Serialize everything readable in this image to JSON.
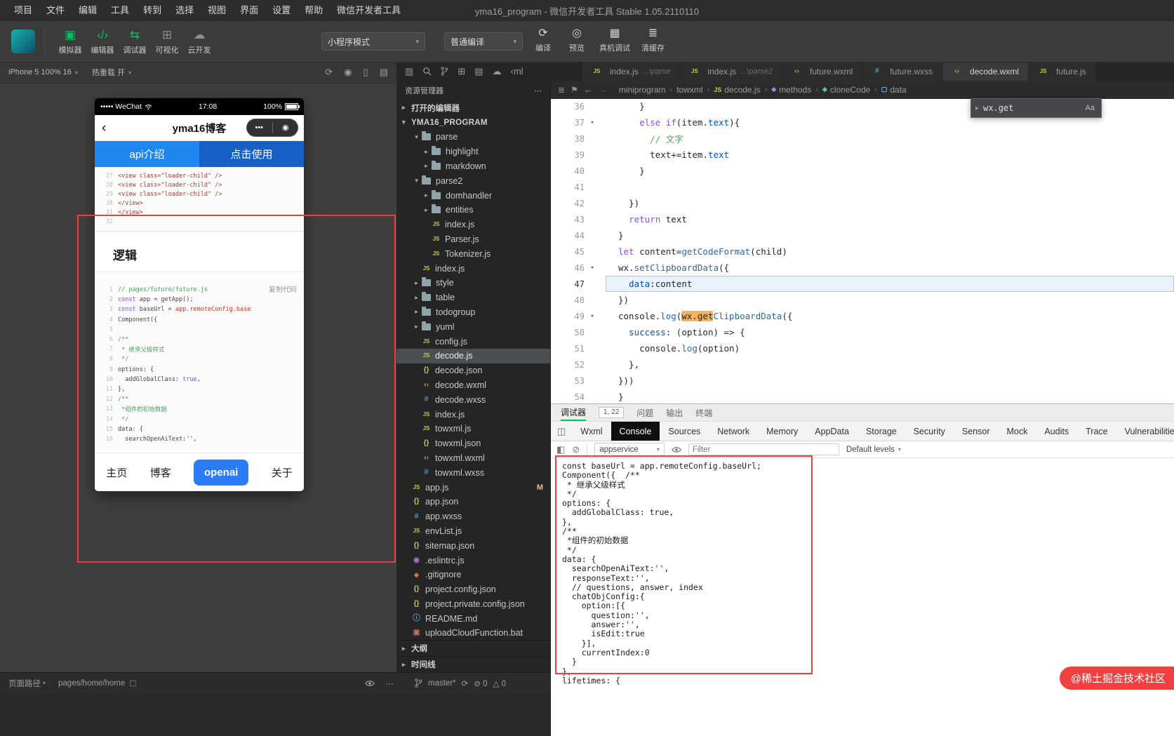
{
  "menubar": {
    "items": [
      "项目",
      "文件",
      "编辑",
      "工具",
      "转到",
      "选择",
      "视图",
      "界面",
      "设置",
      "帮助",
      "微信开发者工具"
    ],
    "title": "yma16_program - 微信开发者工具 Stable 1.05.2110110"
  },
  "toolbar": {
    "nav_buttons": [
      {
        "name": "simulator",
        "label": "模拟器",
        "active": true
      },
      {
        "name": "editor",
        "label": "编辑器",
        "active": true
      },
      {
        "name": "debugger",
        "label": "调试器",
        "active": true
      },
      {
        "name": "visual",
        "label": "可视化",
        "active": false
      },
      {
        "name": "clouddev",
        "label": "云开发",
        "active": false
      }
    ],
    "mode_select": "小程序模式",
    "compile_select": "普通编译",
    "action_buttons": [
      {
        "name": "compile",
        "label": "编译"
      },
      {
        "name": "preview",
        "label": "预览"
      },
      {
        "name": "remote-debug",
        "label": "真机调试"
      },
      {
        "name": "clear-cache",
        "label": "清缓存"
      }
    ]
  },
  "simulator": {
    "device_label": "iPhone 5 100% 16",
    "hot_reload_label": "热重载 开",
    "toolbar_icons": [
      "rotate",
      "record",
      "device",
      "screenshot"
    ],
    "phone": {
      "status": {
        "carrier": "••••• WeChat",
        "time": "17:08",
        "battery": "100%"
      },
      "nav_title": "yma16博客",
      "capsule": {
        "more": "•••",
        "target": "◉"
      },
      "tabs": [
        {
          "label": "api介绍",
          "color": "#1e88f0"
        },
        {
          "label": "点击使用",
          "color": "#1660c8"
        }
      ],
      "wxml_lines": [
        {
          "no": "27",
          "t": "<view class=\"loader-child\" />"
        },
        {
          "no": "28",
          "t": "<view class=\"loader-child\" />"
        },
        {
          "no": "29",
          "t": "<view class=\"loader-child\" />"
        },
        {
          "no": "30",
          "t": "</view>"
        },
        {
          "no": "31",
          "t": "</view>"
        },
        {
          "no": "32",
          "t": ""
        }
      ],
      "section_title": "逻辑",
      "copy_label": "复制代码",
      "logic_lines": [
        {
          "no": "1",
          "seg": [
            [
              "// pages/future/future.js",
              "c"
            ]
          ]
        },
        {
          "no": "2",
          "seg": [
            [
              "const ",
              "k"
            ],
            [
              "app = getApp();",
              ""
            ]
          ]
        },
        {
          "no": "3",
          "seg": [
            [
              "const ",
              "k"
            ],
            [
              "baseUrl = ",
              ""
            ],
            [
              "app.remoteConfig.base",
              "r"
            ]
          ]
        },
        {
          "no": "4",
          "seg": [
            [
              "Component({",
              ""
            ]
          ]
        },
        {
          "no": "5",
          "seg": [
            [
              "",
              ""
            ]
          ]
        },
        {
          "no": "6",
          "seg": [
            [
              "/**",
              "c"
            ]
          ]
        },
        {
          "no": "7",
          "seg": [
            [
              " * 继承父级样式",
              "c"
            ]
          ]
        },
        {
          "no": "8",
          "seg": [
            [
              " */",
              "c"
            ]
          ]
        },
        {
          "no": "9",
          "seg": [
            [
              "options: {",
              ""
            ]
          ]
        },
        {
          "no": "10",
          "seg": [
            [
              "  addGlobalClass: ",
              ""
            ],
            [
              "true",
              "k"
            ],
            [
              ",",
              ""
            ]
          ]
        },
        {
          "no": "11",
          "seg": [
            [
              "},",
              ""
            ]
          ]
        },
        {
          "no": "12",
          "seg": [
            [
              "/**",
              "c"
            ]
          ]
        },
        {
          "no": "13",
          "seg": [
            [
              " *组件的初始数据",
              "c"
            ]
          ]
        },
        {
          "no": "14",
          "seg": [
            [
              " */",
              "c"
            ]
          ]
        },
        {
          "no": "15",
          "seg": [
            [
              "data: {",
              ""
            ]
          ]
        },
        {
          "no": "16",
          "seg": [
            [
              "  searchOpenAiText:'',",
              ""
            ]
          ]
        }
      ],
      "tabbar": [
        {
          "label": "主页",
          "primary": false
        },
        {
          "label": "博客",
          "primary": false
        },
        {
          "label": "openai",
          "primary": true
        },
        {
          "label": "关于",
          "primary": false
        }
      ],
      "primary_color": "#2a7cf7"
    }
  },
  "explorer": {
    "toolbar_icons": [
      "files",
      "search",
      "branch",
      "split",
      "panel",
      "cloud",
      "ml"
    ],
    "panel_title": "资源管理器",
    "more_label": "⋯",
    "open_editors_label": "打开的编辑器",
    "project_label": "YMA16_PROGRAM",
    "tree": [
      {
        "label": "parse",
        "type": "folder",
        "arrow": "down",
        "indent": 1
      },
      {
        "label": "highlight",
        "type": "folder",
        "arrow": "right",
        "indent": 2
      },
      {
        "label": "markdown",
        "type": "folder",
        "arrow": "right",
        "indent": 2
      },
      {
        "label": "parse2",
        "type": "folder",
        "arrow": "down",
        "indent": 1
      },
      {
        "label": "domhandler",
        "type": "folder",
        "arrow": "right",
        "indent": 2
      },
      {
        "label": "entities",
        "type": "folder",
        "arrow": "right",
        "indent": 2
      },
      {
        "label": "index.js",
        "type": "js",
        "indent": 2
      },
      {
        "label": "Parser.js",
        "type": "js",
        "indent": 2
      },
      {
        "label": "Tokenizer.js",
        "type": "js",
        "indent": 2
      },
      {
        "label": "index.js",
        "type": "js",
        "indent": 1
      },
      {
        "label": "style",
        "type": "folder",
        "arrow": "right",
        "indent": 1
      },
      {
        "label": "table",
        "type": "folder",
        "arrow": "right",
        "indent": 1
      },
      {
        "label": "todogroup",
        "type": "folder",
        "arrow": "right",
        "indent": 1
      },
      {
        "label": "yuml",
        "type": "folder",
        "arrow": "right",
        "indent": 1
      },
      {
        "label": "config.js",
        "type": "js",
        "indent": 1
      },
      {
        "label": "decode.js",
        "type": "js",
        "indent": 1,
        "selected": true
      },
      {
        "label": "decode.json",
        "type": "json",
        "indent": 1
      },
      {
        "label": "decode.wxml",
        "type": "wxml",
        "indent": 1
      },
      {
        "label": "decode.wxss",
        "type": "wxss",
        "indent": 1
      },
      {
        "label": "index.js",
        "type": "js",
        "indent": 1
      },
      {
        "label": "towxml.js",
        "type": "js",
        "indent": 1
      },
      {
        "label": "towxml.json",
        "type": "json",
        "indent": 1
      },
      {
        "label": "towxml.wxml",
        "type": "wxml",
        "indent": 1
      },
      {
        "label": "towxml.wxss",
        "type": "wxss",
        "indent": 1
      },
      {
        "label": "app.js",
        "type": "js",
        "indent": 0,
        "badge": "M"
      },
      {
        "label": "app.json",
        "type": "json",
        "indent": 0
      },
      {
        "label": "app.wxss",
        "type": "wxss",
        "indent": 0
      },
      {
        "label": "envList.js",
        "type": "js",
        "indent": 0
      },
      {
        "label": "sitemap.json",
        "type": "json",
        "indent": 0
      },
      {
        "label": ".eslintrc.js",
        "type": "eslint",
        "indent": 0
      },
      {
        "label": ".gitignore",
        "type": "git",
        "indent": 0
      },
      {
        "label": "project.config.json",
        "type": "json",
        "indent": 0
      },
      {
        "label": "project.private.config.json",
        "type": "json",
        "indent": 0
      },
      {
        "label": "README.md",
        "type": "md",
        "indent": 0
      },
      {
        "label": "uploadCloudFunction.bat",
        "type": "bat",
        "indent": 0
      }
    ],
    "outline_label": "大纲",
    "timeline_label": "时间线"
  },
  "statusbar": {
    "page_path_label": "页面路径",
    "page_path": "pages/home/home",
    "branch": "master*",
    "errors": "0",
    "warnings": "0"
  },
  "editor": {
    "tabs": [
      {
        "label": "index.js",
        "hint": "...\\parse",
        "icon": "js",
        "active": false
      },
      {
        "label": "index.js",
        "hint": "...\\parse2",
        "icon": "js",
        "active": false
      },
      {
        "label": "future.wxml",
        "hint": "",
        "icon": "wxml",
        "active": false
      },
      {
        "label": "future.wxss",
        "hint": "",
        "icon": "wxss",
        "active": false
      },
      {
        "label": "decode.wxml",
        "hint": "",
        "icon": "wxml",
        "active": true
      },
      {
        "label": "future.js",
        "hint": "",
        "icon": "js",
        "active": false
      }
    ],
    "breadcrumb": [
      {
        "label": "miniprogram",
        "icon": ""
      },
      {
        "label": "towxml",
        "icon": ""
      },
      {
        "label": "decode.js",
        "icon": "js"
      },
      {
        "label": "methods",
        "icon": "symbol-method"
      },
      {
        "label": "cloneCode",
        "icon": "symbol-method2"
      },
      {
        "label": "data",
        "icon": "symbol-field"
      }
    ],
    "find": {
      "value": "wx.get",
      "case_label": "Aa"
    },
    "code": [
      {
        "no": "36",
        "seg": [
          [
            "    }",
            ""
          ]
        ]
      },
      {
        "no": "37",
        "fold": true,
        "seg": [
          [
            "    ",
            ""
          ],
          [
            "else if",
            "k"
          ],
          [
            "(item.",
            ""
          ],
          [
            "text",
            "p"
          ],
          [
            "){",
            ""
          ]
        ]
      },
      {
        "no": "38",
        "seg": [
          [
            "      // 文字",
            "c"
          ]
        ]
      },
      {
        "no": "39",
        "seg": [
          [
            "      text+=item.",
            ""
          ],
          [
            "text",
            "p"
          ]
        ]
      },
      {
        "no": "40",
        "seg": [
          [
            "    }",
            ""
          ]
        ]
      },
      {
        "no": "41",
        "seg": [
          [
            "",
            ""
          ]
        ]
      },
      {
        "no": "42",
        "seg": [
          [
            "  })",
            ""
          ]
        ]
      },
      {
        "no": "43",
        "seg": [
          [
            "  ",
            ""
          ],
          [
            "return",
            "k"
          ],
          [
            " text",
            ""
          ]
        ]
      },
      {
        "no": "44",
        "seg": [
          [
            "}",
            ""
          ]
        ]
      },
      {
        "no": "45",
        "seg": [
          [
            "let ",
            "k"
          ],
          [
            "content=",
            ""
          ],
          [
            "getCodeFormat",
            "f"
          ],
          [
            "(child)",
            ""
          ]
        ]
      },
      {
        "no": "46",
        "fold": true,
        "seg": [
          [
            "wx.",
            ""
          ],
          [
            "setClipboardData",
            "f"
          ],
          [
            "({",
            ""
          ]
        ]
      },
      {
        "no": "47",
        "cur": true,
        "seg": [
          [
            "  ",
            ""
          ],
          [
            "data",
            "p"
          ],
          [
            ":content",
            ""
          ]
        ]
      },
      {
        "no": "48",
        "seg": [
          [
            "})",
            ""
          ]
        ]
      },
      {
        "no": "49",
        "fold": true,
        "seg": [
          [
            "console.",
            ""
          ],
          [
            "log",
            "f"
          ],
          [
            "(",
            ""
          ],
          [
            "wx.get",
            "m"
          ],
          [
            "ClipboardData",
            "f"
          ],
          [
            "({",
            ""
          ]
        ]
      },
      {
        "no": "50",
        "seg": [
          [
            "  ",
            ""
          ],
          [
            "success",
            "p"
          ],
          [
            ": (option) => {",
            ""
          ]
        ]
      },
      {
        "no": "51",
        "seg": [
          [
            "    console.",
            ""
          ],
          [
            "log",
            "f"
          ],
          [
            "(option)",
            ""
          ]
        ]
      },
      {
        "no": "52",
        "seg": [
          [
            "  },",
            ""
          ]
        ]
      },
      {
        "no": "53",
        "seg": [
          [
            "}))",
            ""
          ]
        ]
      },
      {
        "no": "54",
        "seg": [
          [
            "}",
            ""
          ]
        ]
      }
    ]
  },
  "devtools": {
    "panel_tabs": [
      {
        "label": "调试器",
        "active": true
      },
      {
        "label": "问题",
        "active": false
      },
      {
        "label": "输出",
        "active": false
      },
      {
        "label": "终端",
        "active": false
      }
    ],
    "cursor_pos": "1, 22",
    "tool_tabs": [
      {
        "label": "Wxml",
        "active": false
      },
      {
        "label": "Console",
        "active": true
      },
      {
        "label": "Sources",
        "active": false
      },
      {
        "label": "Network",
        "active": false
      },
      {
        "label": "Memory",
        "active": false
      },
      {
        "label": "AppData",
        "active": false
      },
      {
        "label": "Storage",
        "active": false
      },
      {
        "label": "Security",
        "active": false
      },
      {
        "label": "Sensor",
        "active": false
      },
      {
        "label": "Mock",
        "active": false
      },
      {
        "label": "Audits",
        "active": false
      },
      {
        "label": "Trace",
        "active": false
      },
      {
        "label": "Vulnerabilities",
        "active": false
      }
    ],
    "context_select": "appservice",
    "filter_placeholder": "Filter",
    "levels_select": "Default levels",
    "console_lines": [
      "const baseUrl = app.remoteConfig.baseUrl;",
      "Component({  /**",
      " * 继承父级样式",
      " */",
      "options: {",
      "  addGlobalClass: true,",
      "},",
      "/**",
      " *组件的初始数据",
      " */",
      "data: {",
      "  searchOpenAiText:'',",
      "  responseText:'',",
      "  // questions, answer, index",
      "  chatObjConfig:{",
      "    option:[{",
      "      question:'',",
      "      answer:'',",
      "      isEdit:true",
      "    }],",
      "    currentIndex:0",
      "  }",
      "},",
      "lifetimes: {"
    ]
  },
  "watermark": "@稀土掘金技术社区"
}
